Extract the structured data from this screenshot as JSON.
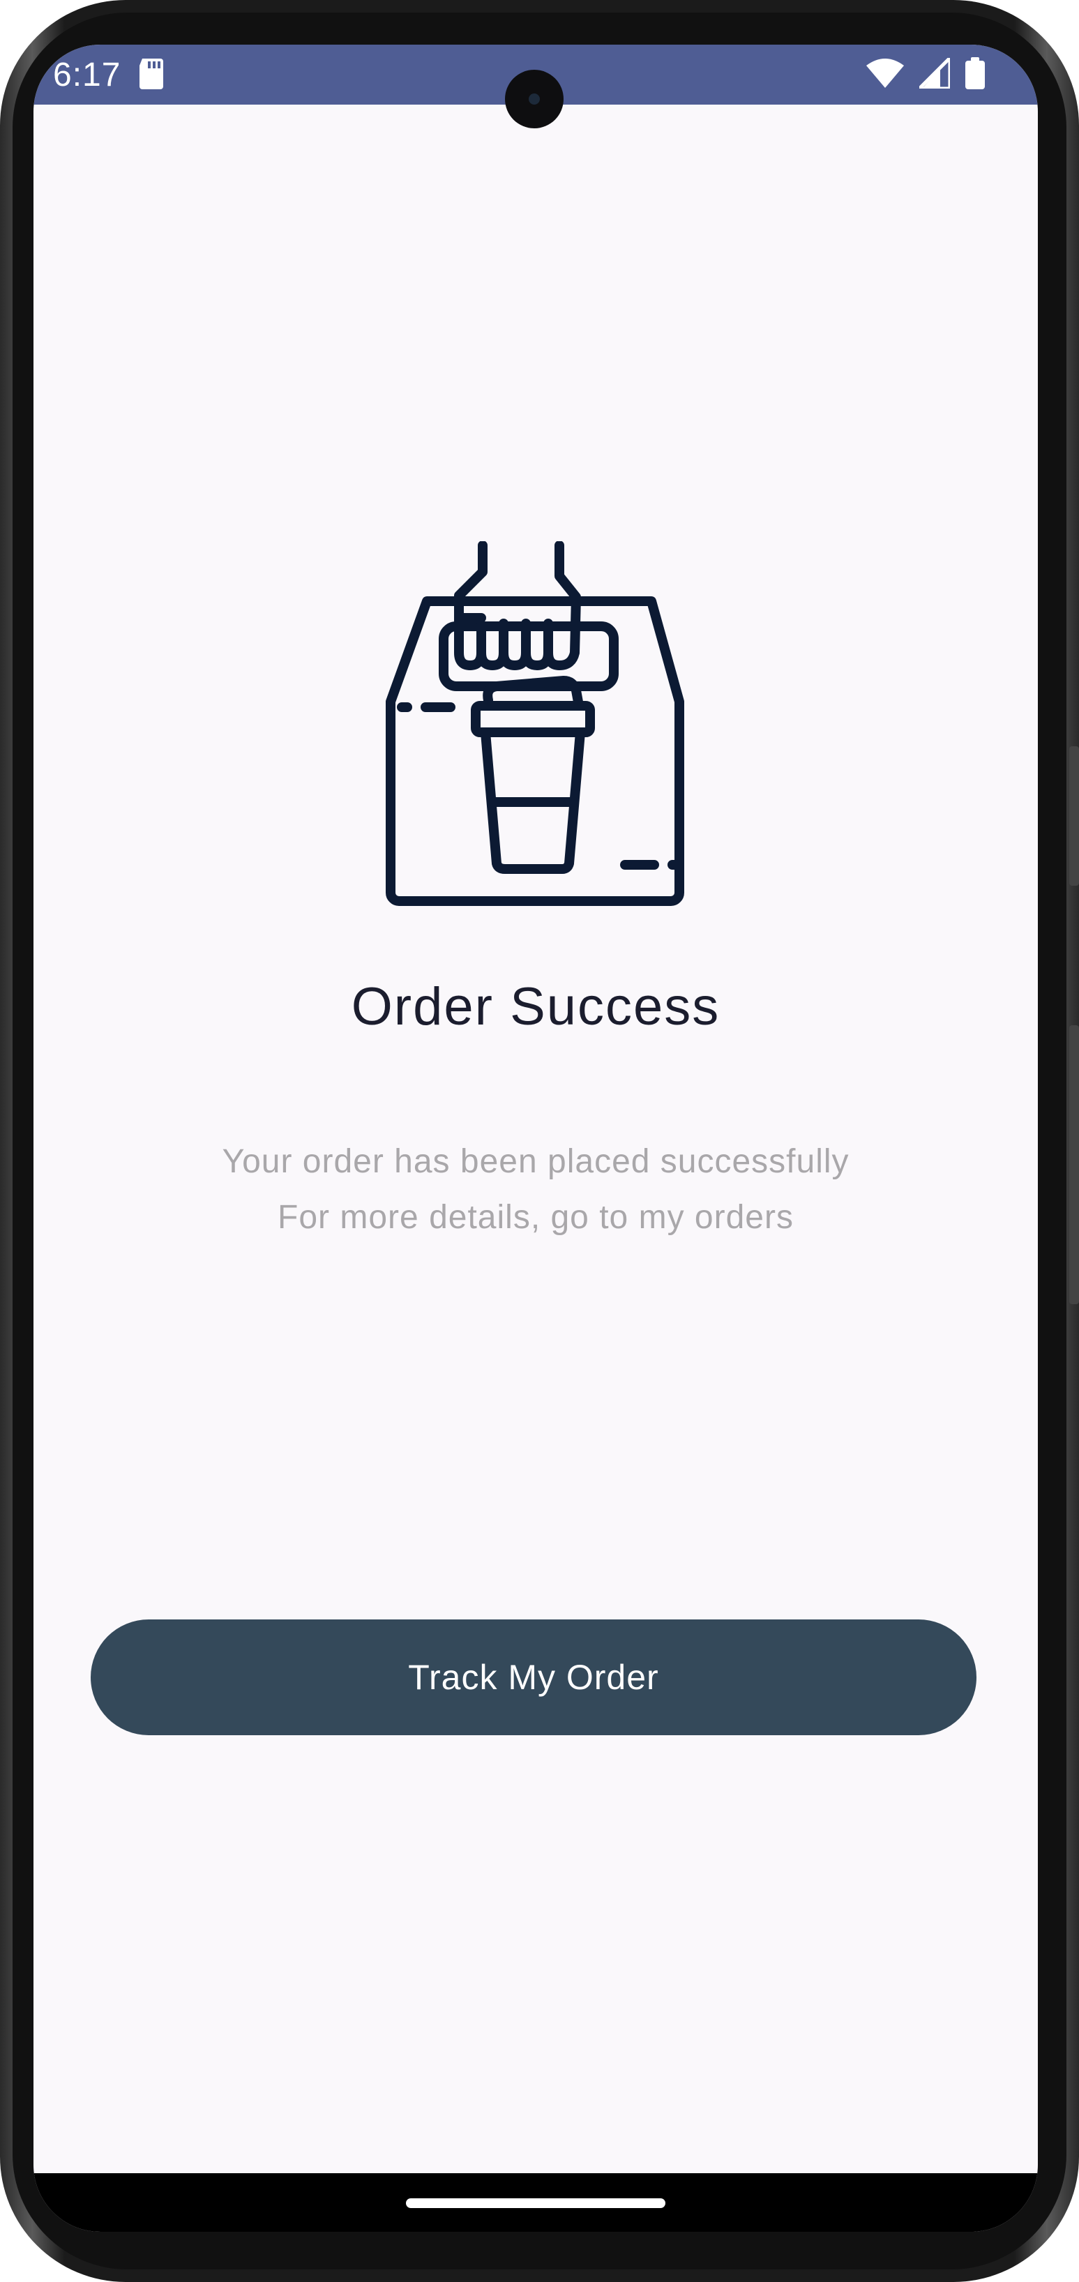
{
  "status_bar": {
    "time": "6:17",
    "icons": [
      "sd-card-icon",
      "wifi-icon",
      "cell-signal-icon",
      "battery-icon"
    ],
    "background_color": "#4f5d94"
  },
  "illustration": {
    "icon": "takeaway-coffee-box-icon",
    "color": "#0c1a33"
  },
  "main": {
    "title": "Order Success",
    "message_line1": "Your order has been placed successfully",
    "message_line2": "For more details, go to my orders"
  },
  "actions": {
    "track_button_label": "Track My Order",
    "track_button_color": "#34495a"
  }
}
